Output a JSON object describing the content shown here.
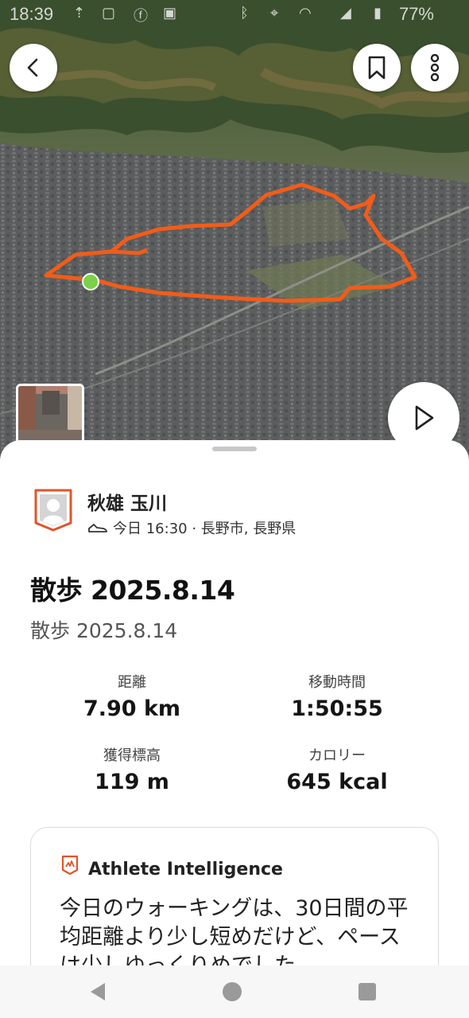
{
  "status_bar": {
    "time": "18:39",
    "battery": "77%"
  },
  "map": {
    "route_color": "#f25c19",
    "start_marker_color": "#7bd14a"
  },
  "activity": {
    "athlete_name": "秋雄 玉川",
    "meta": "今日 16:30 · 長野市, 長野県",
    "title": "散歩 2025.8.14",
    "description": "散歩 2025.8.14",
    "stats": [
      {
        "label": "距離",
        "value": "7.90 km"
      },
      {
        "label": "移動時間",
        "value": "1:50:55"
      },
      {
        "label": "獲得標高",
        "value": "119 m"
      },
      {
        "label": "カロリー",
        "value": "645 kcal"
      }
    ]
  },
  "athlete_intelligence": {
    "title": "Athlete Intelligence",
    "text": "今日のウォーキングは、30日間の平均距離より少し短めだけど、ペースは少しゆっくりめでした。"
  },
  "colors": {
    "accent": "#fc4c02"
  },
  "icons": {
    "back": "chevron-left-icon",
    "bookmark": "bookmark-icon",
    "more": "more-vertical-icon",
    "play": "play-icon",
    "shoe": "shoe-icon"
  }
}
